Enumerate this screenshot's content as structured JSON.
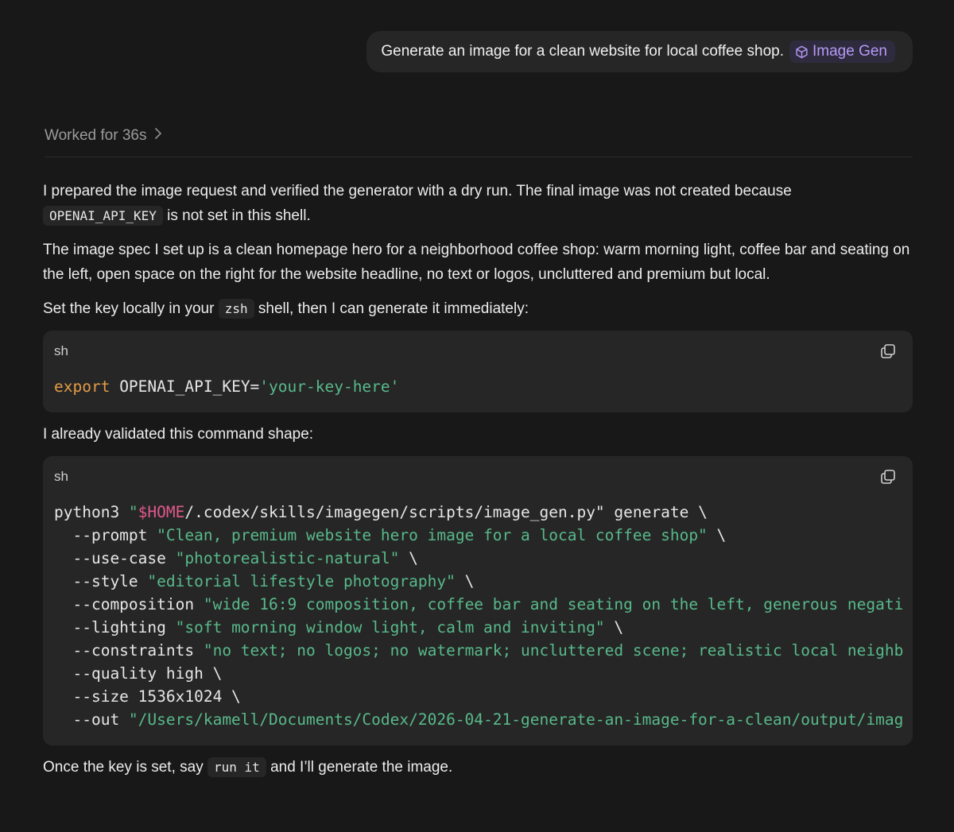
{
  "user_message": {
    "text": "Generate an image for a clean website for local coffee shop.",
    "skill_chip": "Image Gen",
    "skill_icon": "cube-icon",
    "skill_color": "#b69af5"
  },
  "status": {
    "worked_label": "Worked for 36s",
    "chevron_icon": "chevron-right-icon"
  },
  "reply": {
    "p1_a": "I prepared the image request and verified the generator with a dry run. The final image was not created because",
    "p1_code": "OPENAI_API_KEY",
    "p1_b": "is not set in this shell.",
    "p2": "The image spec I set up is a clean homepage hero for a neighborhood coffee shop: warm morning light, coffee bar and seating on the left, open space on the right for the website headline, no text or logos, uncluttered and premium but local.",
    "p3_a": "Set the key locally in your",
    "p3_code": "zsh",
    "p3_b": "shell, then I can generate it immediately:",
    "p4": "I already validated this command shape:",
    "p5_a": "Once the key is set, say",
    "p5_code": "run it",
    "p5_b": "and I’ll generate the image."
  },
  "code_block_1": {
    "lang": "sh",
    "copy_icon": "copy-icon",
    "keyword": "export",
    "assignment": " OPENAI_API_KEY=",
    "value": "'your-key-here'"
  },
  "code_block_2": {
    "lang": "sh",
    "copy_icon": "copy-icon",
    "line1": {
      "cmd": "python3 ",
      "quote_open": "\"",
      "var": "$HOME",
      "path": "/.codex/skills/imagegen/scripts/image_gen.py\"",
      "rest": " generate \\"
    },
    "flags": [
      {
        "flag": "  --prompt ",
        "value": "\"Clean, premium website hero image for a local coffee shop\"",
        "tail": " \\"
      },
      {
        "flag": "  --use-case ",
        "value": "\"photorealistic-natural\"",
        "tail": " \\"
      },
      {
        "flag": "  --style ",
        "value": "\"editorial lifestyle photography\"",
        "tail": " \\"
      },
      {
        "flag": "  --composition ",
        "value": "\"wide 16:9 composition, coffee bar and seating on the left, generous negati",
        "tail": ""
      },
      {
        "flag": "  --lighting ",
        "value": "\"soft morning window light, calm and inviting\"",
        "tail": " \\"
      },
      {
        "flag": "  --constraints ",
        "value": "\"no text; no logos; no watermark; uncluttered scene; realistic local neighb",
        "tail": ""
      },
      {
        "flag": "  --quality high \\",
        "value": "",
        "tail": ""
      },
      {
        "flag": "  --size 1536x1024 \\",
        "value": "",
        "tail": ""
      },
      {
        "flag": "  --out ",
        "value": "\"/Users/kamell/Documents/Codex/2026-04-21-generate-an-image-for-a-clean/output/imag",
        "tail": ""
      }
    ]
  },
  "colors": {
    "background": "#181818",
    "code_bg": "#262626",
    "keyword": "#e59b46",
    "string": "#58b98a",
    "variable": "#e0598b"
  }
}
